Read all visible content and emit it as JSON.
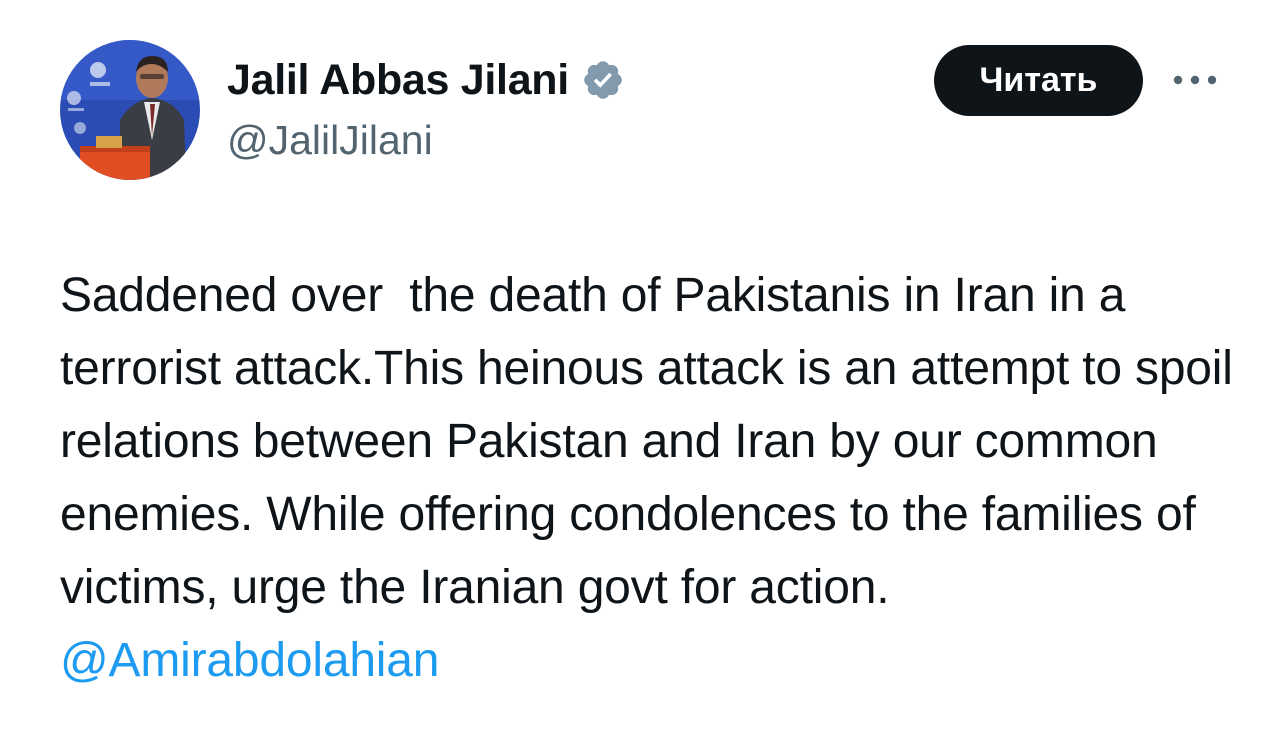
{
  "author": {
    "display_name": "Jalil Abbas Jilani",
    "handle": "@JalilJilani",
    "verified_icon": "verified-badge-icon",
    "avatar": "profile-photo"
  },
  "actions": {
    "follow_label": "Читать",
    "more_icon": "more-dots-icon"
  },
  "tweet": {
    "text": "Saddened over  the death of Pakistanis in Iran in a terrorist attack.This heinous attack is an attempt to spoil relations between Pakistan and Iran by our common enemies. While offering condolences to the families of victims, urge the Iranian govt for action. ",
    "mention": "@Amirabdolahian"
  },
  "colors": {
    "text": "#0f1419",
    "secondary": "#536471",
    "link": "#1d9bf0",
    "button_bg": "#0f1419",
    "badge": "#829aab"
  }
}
